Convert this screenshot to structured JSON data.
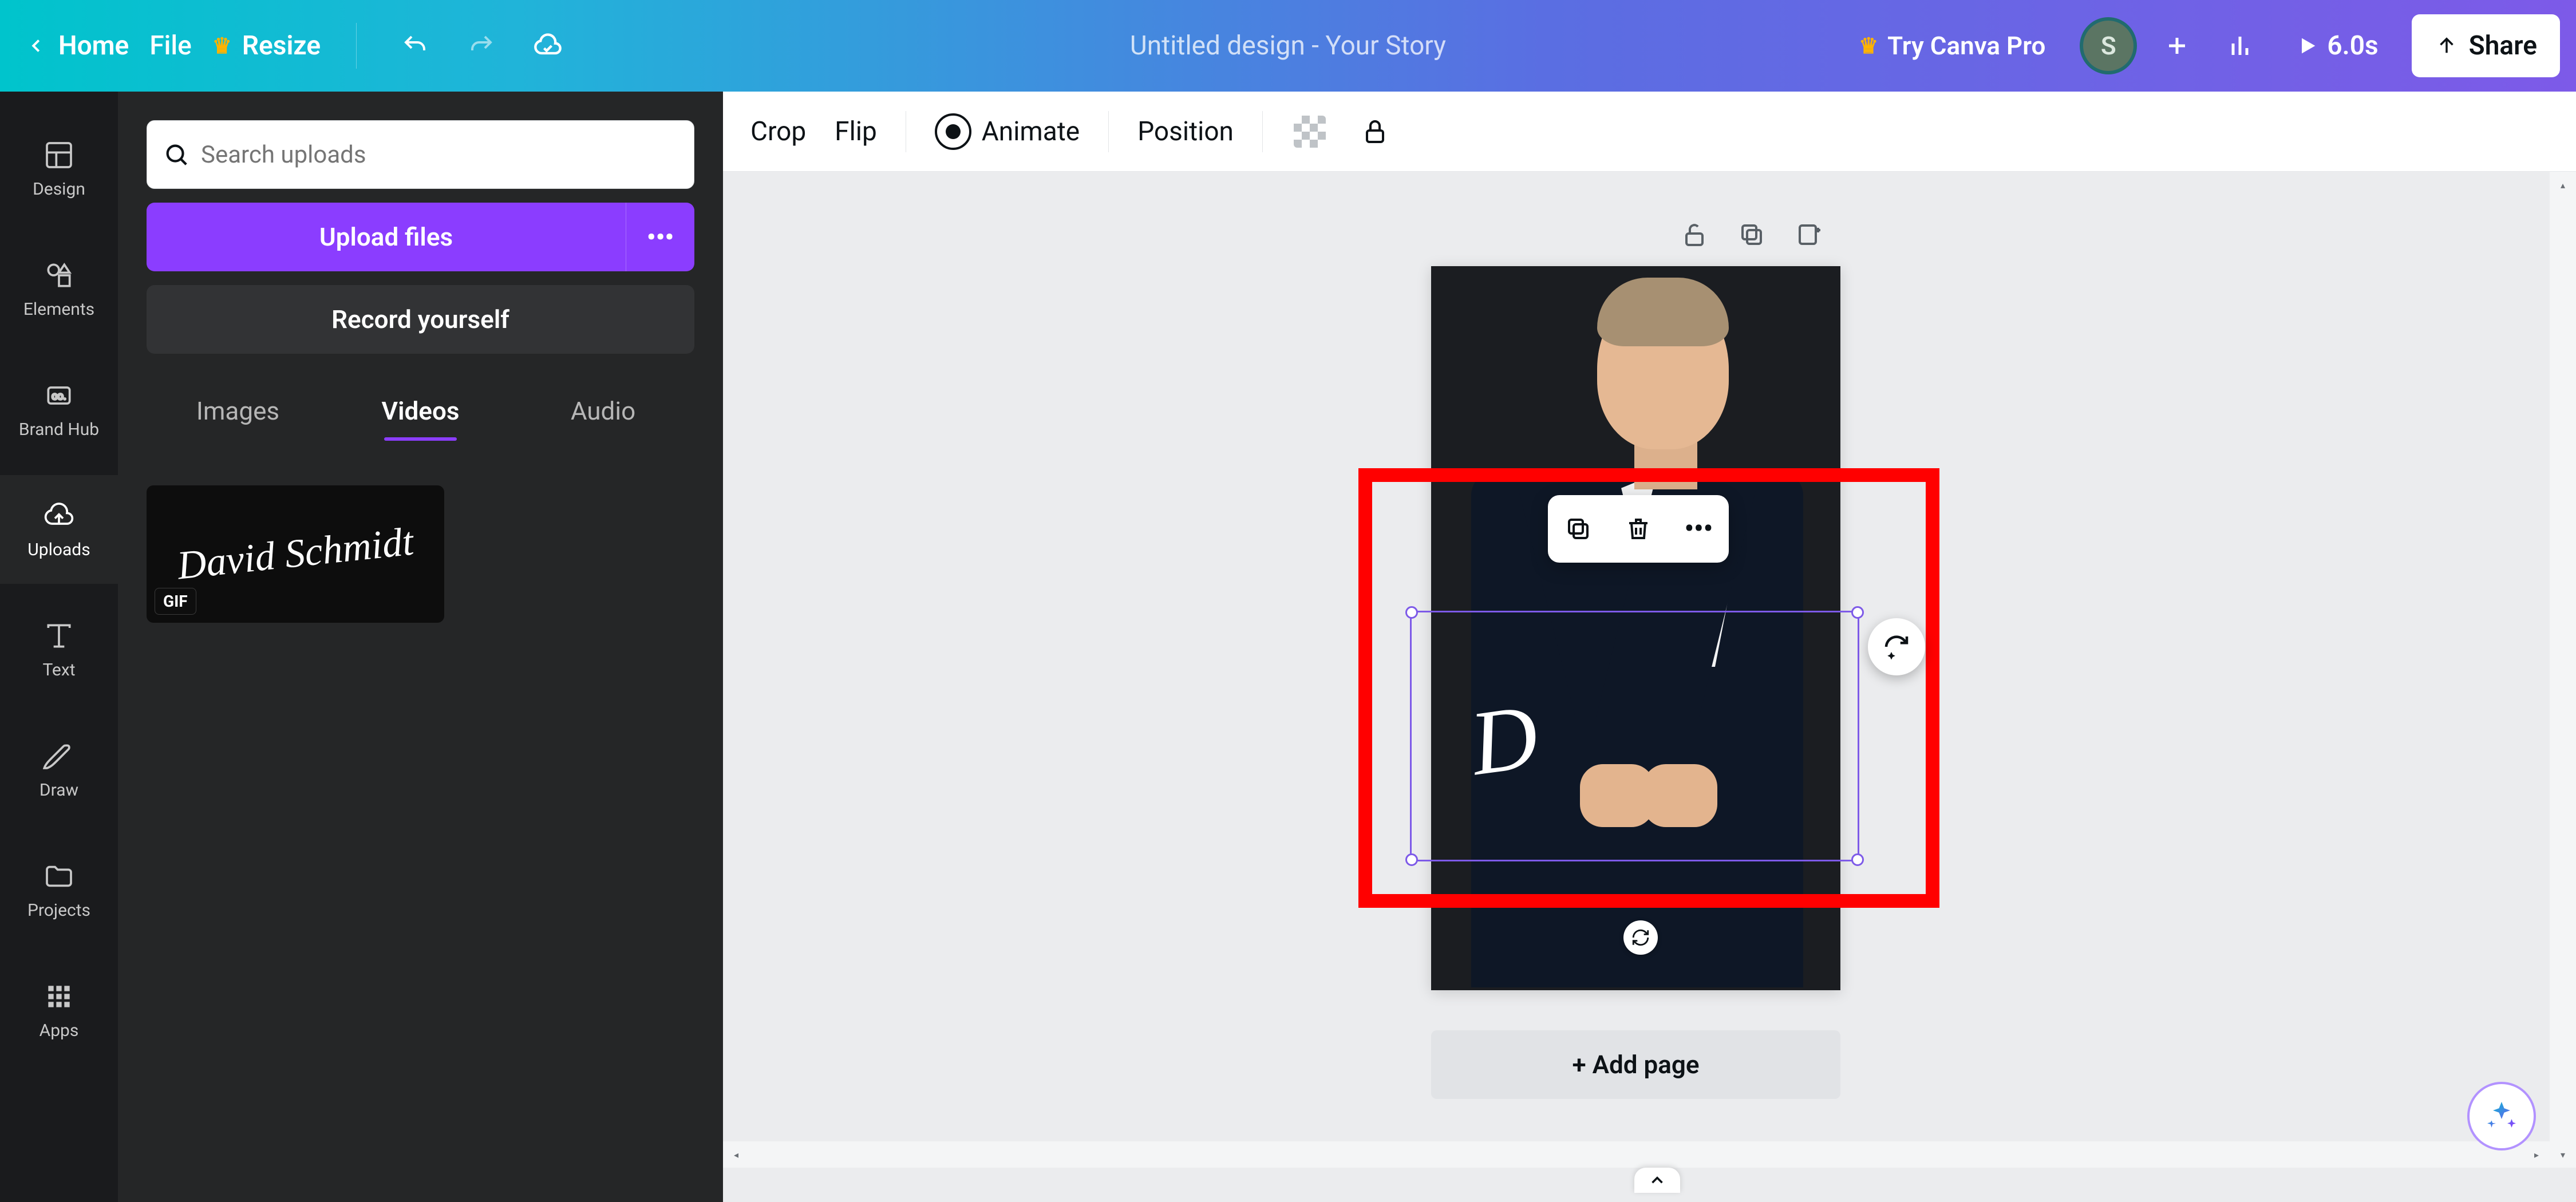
{
  "topbar": {
    "home": "Home",
    "file": "File",
    "resize": "Resize",
    "doc_title": "Untitled design - Your Story",
    "try_pro": "Try Canva Pro",
    "avatar_initial": "S",
    "duration": "6.0s",
    "share": "Share"
  },
  "rail": {
    "design": "Design",
    "elements": "Elements",
    "brand": "Brand Hub",
    "uploads": "Uploads",
    "text": "Text",
    "draw": "Draw",
    "projects": "Projects",
    "apps": "Apps"
  },
  "panel": {
    "search_placeholder": "Search uploads",
    "upload": "Upload files",
    "record": "Record yourself",
    "tabs": {
      "images": "Images",
      "videos": "Videos",
      "audio": "Audio"
    },
    "active_tab": "Videos",
    "thumb_text": "David Schmidt",
    "gif_badge": "GIF"
  },
  "ctx": {
    "crop": "Crop",
    "flip": "Flip",
    "animate": "Animate",
    "position": "Position"
  },
  "canvas": {
    "add_page": "+ Add page",
    "sig_preview": "D"
  },
  "colors": {
    "accent": "#8b3dff",
    "highlight": "#ff0000",
    "selection": "#7d5ae8"
  }
}
